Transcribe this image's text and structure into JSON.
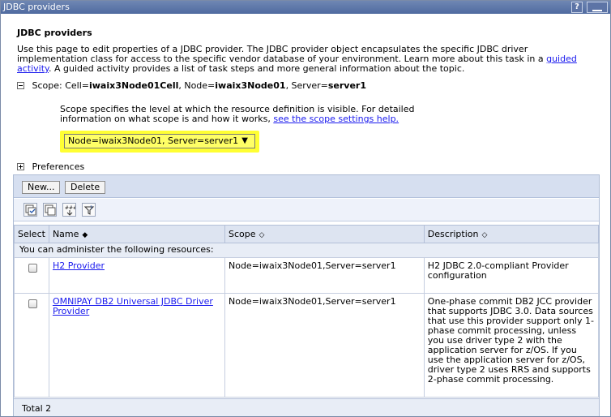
{
  "window": {
    "title": "JDBC providers",
    "help_label": "?"
  },
  "page": {
    "heading": "JDBC providers",
    "intro_text": "Use this page to edit properties of a JDBC provider. The JDBC provider object encapsulates the specific JDBC driver implementation class for access to the specific vendor database of your environment. Learn more about this task in a ",
    "intro_link": "guided activity",
    "intro_text_after": ". A guided activity provides a list of task steps and more general information about the topic."
  },
  "scope": {
    "label": "Scope:",
    "cell_label": "Cell=",
    "cell": "iwaix3Node01Cell",
    "node_label": ", Node=",
    "node": "iwaix3Node01",
    "server_label": ", Server=",
    "server": "server1",
    "description": "Scope specifies the level at which the resource definition is visible. For detailed information on what scope is and how it works, ",
    "help_link": "see the scope settings help.",
    "selected": "Node=iwaix3Node01, Server=server1",
    "arrow": "▼"
  },
  "preferences": {
    "label": "Preferences"
  },
  "toolbar": {
    "new_label": "New...",
    "delete_label": "Delete"
  },
  "table": {
    "columns": {
      "select": "Select",
      "name": "Name",
      "scope": "Scope",
      "description": "Description"
    },
    "sort_glyph": "◇",
    "name_sort_glyph": "◆",
    "subhead": "You can administer the following resources:",
    "rows": [
      {
        "name": "H2 Provider",
        "scope": "Node=iwaix3Node01,Server=server1",
        "description": "H2 JDBC 2.0-compliant Provider configuration"
      },
      {
        "name": "OMNIPAY DB2 Universal JDBC Driver Provider",
        "scope": "Node=iwaix3Node01,Server=server1",
        "description": "One-phase commit DB2 JCC provider that supports JDBC 3.0. Data sources that use this provider support only 1-phase commit processing, unless you use driver type 2 with the application server for z/OS. If you use the application server for z/OS, driver type 2 uses RRS and supports 2-phase commit processing."
      }
    ],
    "total": "Total 2"
  },
  "icons": [
    "select-all-icon",
    "deselect-all-icon",
    "filter-icon",
    "show-filter-icon"
  ],
  "colors": {
    "titlebar": "#5870a4",
    "highlight": "#ffff33",
    "link": "#1a1aee"
  }
}
